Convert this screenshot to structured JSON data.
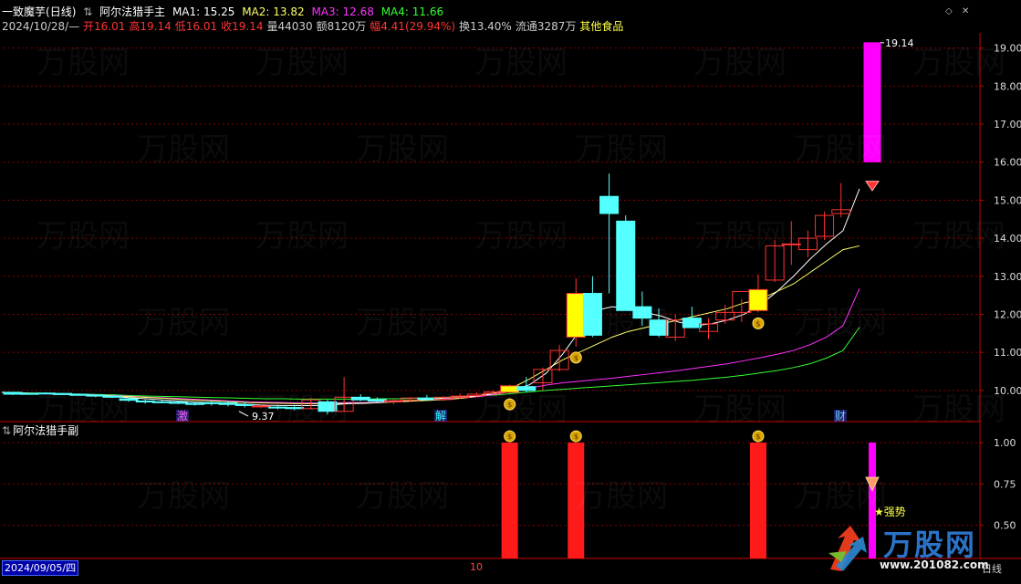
{
  "header": {
    "stock_name": "一致魔芋",
    "period": "(日线)",
    "indicator_main": "阿尔法猎手主",
    "ma": [
      {
        "label": "MA1: 15.25",
        "color": "#ffffff"
      },
      {
        "label": "MA2: 13.82",
        "color": "#ffff66"
      },
      {
        "label": "MA3: 12.68",
        "color": "#ff33ff"
      },
      {
        "label": "MA4: 11.66",
        "color": "#33ff33"
      }
    ],
    "quote": {
      "date": "2024/10/28/—",
      "open": "开16.01",
      "high": "高19.14",
      "low": "低16.01",
      "close": "收19.14",
      "volume": "量44030",
      "amount": "额8120万",
      "change": "幅4.41(29.94%)",
      "turnover": "换13.40%",
      "float": "流通3287万",
      "sector": "其他食品"
    }
  },
  "main_chart": {
    "y_ticks": [
      "19.00",
      "18.00",
      "17.00",
      "16.00",
      "15.00",
      "14.00",
      "13.00",
      "12.00",
      "11.00",
      "10.00"
    ],
    "max_price_label": "19.14",
    "min_price_label": "9.37",
    "markers": [
      {
        "text": "激",
        "color": "#ff66ff"
      },
      {
        "text": "解",
        "color": "#33ffff"
      },
      {
        "text": "财",
        "color": "#66ccff"
      }
    ]
  },
  "sub_chart": {
    "title": "阿尔法猎手副",
    "y_ticks": [
      "1.00",
      "0.75",
      "0.50"
    ],
    "strong_label": "★强势"
  },
  "footer": {
    "date_label": "2024/09/05/四",
    "mid_label": "10",
    "right_label": "日线"
  },
  "watermark": {
    "brand": "万股网",
    "url": "www.201082.com"
  },
  "colors": {
    "up": "#ff3333",
    "down": "#54ffff",
    "signal": "#ffff00",
    "magenta": "#ff00ff",
    "grid": "#8b0000",
    "bg": "#000000"
  },
  "chart_data": {
    "type": "candlestick",
    "ohlc": [
      [
        9.95,
        9.92,
        9.88,
        9.9
      ],
      [
        9.92,
        9.93,
        9.89,
        9.91
      ],
      [
        9.93,
        9.95,
        9.9,
        9.92
      ],
      [
        9.92,
        9.93,
        9.88,
        9.89
      ],
      [
        9.9,
        9.92,
        9.86,
        9.87
      ],
      [
        9.88,
        9.9,
        9.82,
        9.85
      ],
      [
        9.85,
        9.88,
        9.8,
        9.82
      ],
      [
        9.78,
        9.82,
        9.7,
        9.74
      ],
      [
        9.72,
        9.78,
        9.65,
        9.7
      ],
      [
        9.7,
        9.74,
        9.66,
        9.69
      ],
      [
        9.69,
        9.72,
        9.64,
        9.66
      ],
      [
        9.66,
        9.7,
        9.6,
        9.63
      ],
      [
        9.68,
        9.72,
        9.6,
        9.65
      ],
      [
        9.67,
        9.72,
        9.58,
        9.63
      ],
      [
        9.63,
        9.7,
        9.55,
        9.6
      ],
      [
        9.58,
        9.64,
        9.53,
        9.59
      ],
      [
        9.56,
        9.62,
        9.5,
        9.54
      ],
      [
        9.55,
        9.62,
        9.48,
        9.52
      ],
      [
        9.52,
        9.8,
        9.5,
        9.75
      ],
      [
        9.7,
        9.75,
        9.37,
        9.45
      ],
      [
        9.45,
        10.35,
        9.44,
        9.82
      ],
      [
        9.82,
        9.9,
        9.72,
        9.75
      ],
      [
        9.76,
        9.82,
        9.68,
        9.72
      ],
      [
        9.7,
        9.78,
        9.64,
        9.73
      ],
      [
        9.74,
        9.82,
        9.7,
        9.8
      ],
      [
        9.8,
        9.88,
        9.74,
        9.76
      ],
      [
        9.76,
        9.85,
        9.72,
        9.82
      ],
      [
        9.82,
        9.92,
        9.78,
        9.85
      ],
      [
        9.86,
        9.95,
        9.82,
        9.9
      ],
      [
        9.92,
        10.0,
        9.88,
        9.96
      ],
      [
        9.95,
        10.15,
        9.92,
        10.12
      ],
      [
        10.1,
        10.35,
        9.95,
        10.0
      ],
      [
        10.2,
        10.6,
        10.0,
        10.55
      ],
      [
        10.55,
        11.2,
        10.5,
        11.05
      ],
      [
        11.4,
        12.95,
        11.15,
        12.55
      ],
      [
        12.55,
        13.0,
        11.4,
        11.45
      ],
      [
        15.1,
        15.7,
        12.55,
        14.65
      ],
      [
        14.45,
        14.6,
        12.1,
        12.1
      ],
      [
        12.2,
        12.6,
        11.7,
        11.9
      ],
      [
        11.85,
        12.15,
        11.4,
        11.45
      ],
      [
        11.4,
        12.0,
        11.3,
        11.85
      ],
      [
        11.9,
        12.2,
        11.65,
        11.65
      ],
      [
        11.55,
        11.9,
        11.35,
        11.75
      ],
      [
        11.85,
        12.25,
        11.75,
        12.05
      ],
      [
        12.05,
        12.4,
        11.8,
        12.6
      ],
      [
        12.1,
        13.05,
        12.05,
        12.65
      ],
      [
        12.9,
        13.95,
        12.85,
        13.8
      ],
      [
        13.85,
        14.45,
        13.3,
        13.85
      ],
      [
        13.7,
        14.2,
        13.5,
        14.0
      ],
      [
        14.05,
        14.7,
        13.95,
        14.6
      ],
      [
        14.65,
        15.45,
        14.55,
        14.75
      ],
      [
        16.01,
        19.14,
        16.01,
        19.14
      ]
    ],
    "ma1": [
      9.95,
      9.93,
      9.92,
      9.91,
      9.9,
      9.88,
      9.86,
      9.83,
      9.8,
      9.77,
      9.74,
      9.71,
      9.69,
      9.67,
      9.65,
      9.63,
      9.61,
      9.6,
      9.6,
      9.6,
      9.62,
      9.65,
      9.66,
      9.68,
      9.72,
      9.74,
      9.77,
      9.8,
      9.83,
      9.86,
      9.92,
      10.0,
      10.15,
      10.45,
      10.95,
      11.55,
      12.1,
      12.2,
      12.15,
      12.05,
      11.95,
      11.8,
      11.7,
      11.75,
      11.85,
      12.0,
      12.25,
      12.6,
      13.0,
      13.45,
      13.85,
      14.2,
      15.3
    ],
    "ma2": [
      9.95,
      9.93,
      9.92,
      9.91,
      9.9,
      9.89,
      9.87,
      9.85,
      9.83,
      9.81,
      9.79,
      9.76,
      9.74,
      9.72,
      9.7,
      9.68,
      9.67,
      9.66,
      9.65,
      9.65,
      9.65,
      9.66,
      9.67,
      9.68,
      9.7,
      9.72,
      9.74,
      9.76,
      9.8,
      9.86,
      9.95,
      10.08,
      10.3,
      10.55,
      10.8,
      11.0,
      11.2,
      11.4,
      11.55,
      11.65,
      11.75,
      11.85,
      11.95,
      12.05,
      12.15,
      12.3,
      12.4,
      12.6,
      12.8,
      13.1,
      13.4,
      13.7,
      13.8
    ],
    "ma3": [
      9.95,
      9.93,
      9.92,
      9.91,
      9.9,
      9.89,
      9.88,
      9.86,
      9.84,
      9.82,
      9.8,
      9.78,
      9.76,
      9.74,
      9.72,
      9.7,
      9.69,
      9.68,
      9.67,
      9.67,
      9.67,
      9.68,
      9.68,
      9.69,
      9.71,
      9.73,
      9.75,
      9.77,
      9.8,
      9.84,
      9.9,
      9.98,
      10.06,
      10.14,
      10.2,
      10.24,
      10.28,
      10.32,
      10.37,
      10.42,
      10.47,
      10.52,
      10.58,
      10.64,
      10.7,
      10.78,
      10.86,
      10.95,
      11.05,
      11.2,
      11.4,
      11.7,
      12.68
    ],
    "ma4": [
      9.95,
      9.94,
      9.93,
      9.92,
      9.91,
      9.9,
      9.89,
      9.88,
      9.86,
      9.85,
      9.84,
      9.83,
      9.82,
      9.81,
      9.8,
      9.79,
      9.78,
      9.78,
      9.77,
      9.77,
      9.77,
      9.77,
      9.77,
      9.78,
      9.78,
      9.79,
      9.8,
      9.82,
      9.84,
      9.86,
      9.88,
      9.92,
      9.96,
      10.0,
      10.03,
      10.06,
      10.09,
      10.12,
      10.15,
      10.18,
      10.21,
      10.24,
      10.27,
      10.31,
      10.35,
      10.4,
      10.46,
      10.52,
      10.6,
      10.7,
      10.85,
      11.05,
      11.66
    ],
    "ylim": [
      9.37,
      19.14
    ],
    "signal_bars": [
      30,
      34,
      45
    ],
    "sub_signal_bars": [
      30,
      34,
      45
    ],
    "sub_ylim": [
      0.3,
      1.05
    ]
  }
}
